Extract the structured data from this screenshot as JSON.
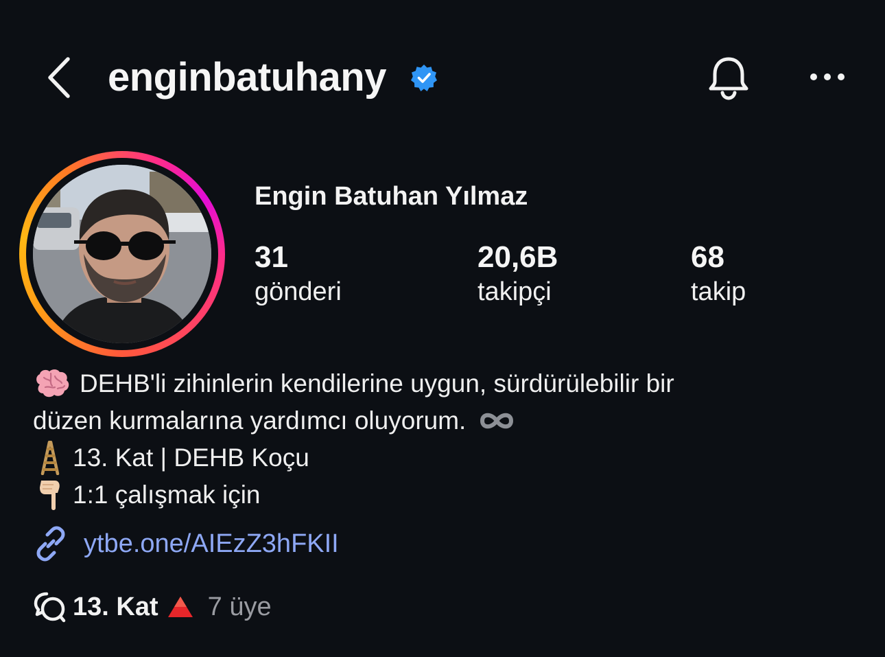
{
  "header": {
    "username": "enginbatuhany",
    "verified": true
  },
  "profile": {
    "full_name": "Engin Batuhan Yılmaz",
    "stats": [
      {
        "value": "31",
        "label": "gönderi"
      },
      {
        "value": "20,6B",
        "label": "takipçi"
      },
      {
        "value": "68",
        "label": "takip"
      }
    ],
    "story_ring_colors": [
      "#ff2d87",
      "#e20dd6",
      "#ff9d16",
      "#ffb814"
    ]
  },
  "bio": {
    "line1_emoji": "brain-emoji",
    "line1": "DEHB'li zihinlerin kendilerine uygun, sürdürülebilir bir",
    "line2": "düzen kurmalarına yardımcı oluyorum.",
    "line2_emoji": "infinity-emoji",
    "line3_emoji": "ladder-emoji",
    "line3": "13. Kat | DEHB Koçu",
    "line4_emoji": "backhand-index-pointing-down-emoji",
    "line4": "1:1 çalışmak için"
  },
  "link": {
    "icon": "link-icon",
    "text": "ytbe.one/AIEzZ3hFKII",
    "color": "#8ea8f5"
  },
  "channel": {
    "icon": "broadcast-channel-icon",
    "name": "13. Kat",
    "name_emoji": "red-triangle-emoji",
    "members": "7 üye"
  },
  "colors": {
    "background": "#0c0f14",
    "verified_badge": "#2f95f5",
    "muted_text": "#9a9ca2"
  }
}
